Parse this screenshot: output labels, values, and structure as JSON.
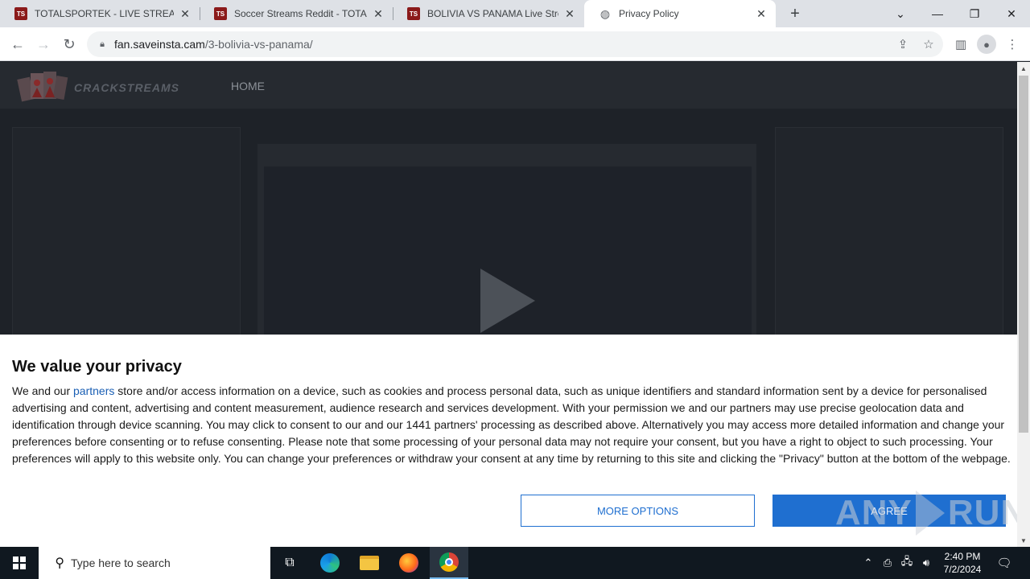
{
  "browser": {
    "tabs": [
      {
        "favicon": "TS",
        "title": "TOTALSPORTEK - LIVE STREAMS",
        "active": false
      },
      {
        "favicon": "TS",
        "title": "Soccer Streams Reddit - TOTALSPORTEK",
        "active": false
      },
      {
        "favicon": "TS",
        "title": "BOLIVIA VS PANAMA Live Stream",
        "active": false
      },
      {
        "favicon": "globe-icon",
        "title": "Privacy Policy",
        "active": true
      }
    ],
    "new_tab_glyph": "+",
    "url_host": "fan.saveinsta.cam",
    "url_path": "/3-bolivia-vs-panama/"
  },
  "site": {
    "logo_text": "CRACKSTREAMS",
    "nav": {
      "home": "HOME"
    }
  },
  "consent": {
    "heading": "We value your privacy",
    "text_before_link": "We and our ",
    "link_text": "partners",
    "text_after_link": " store and/or access information on a device, such as cookies and process personal data, such as unique identifiers and standard information sent by a device for personalised advertising and content, advertising and content measurement, audience research and services development. With your permission we and our partners may use precise geolocation data and identification through device scanning. You may click to consent to our and our 1441 partners' processing as described above. Alternatively you may access more detailed information and change your preferences before consenting or to refuse consenting. Please note that some processing of your personal data may not require your consent, but you have a right to object to such processing. Your preferences will apply to this website only. You can change your preferences or withdraw your consent at any time by returning to this site and clicking the \"Privacy\" button at the bottom of the webpage.",
    "more_options_label": "MORE OPTIONS",
    "agree_label": "AGREE"
  },
  "watermark": {
    "left": "ANY",
    "right": "RUN"
  },
  "taskbar": {
    "search_placeholder": "Type here to search",
    "time": "2:40 PM",
    "date": "7/2/2024"
  },
  "colors": {
    "accent_blue": "#1f6fd0",
    "page_bg": "#1e2228",
    "taskbar_bg": "#101820"
  }
}
